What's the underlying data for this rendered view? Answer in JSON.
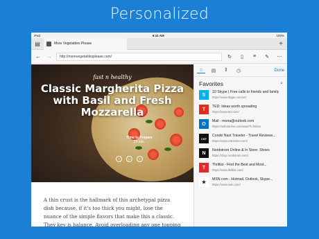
{
  "headline": "Personalized",
  "status": {
    "left": "iPad",
    "time": "9:41 AM",
    "battery": "100%"
  },
  "tab": {
    "title": "More Vegetables Please"
  },
  "address": {
    "url": "http://morevegetablesplease.com/"
  },
  "hero": {
    "brand": "fast n healthy",
    "title": "Classic Margherita Pizza with Basil and Fresh Mozzarella",
    "prep_label": "Time to Prepare",
    "prep_value": "25 min."
  },
  "article": {
    "text": "A thin crust is the hallmark of this archetypal pizza dish because, if it's too thick you might, lose the nuance of the simple flavors that make this a classic. They key is balance. Avoid overloading any one topping or flavor. Instead, let the simple ingredients"
  },
  "hub": {
    "done": "Done",
    "title": "Favorites",
    "items": [
      {
        "title": "10 Skype | Free calls to friends and family",
        "url": "https://www.skype.com/en/",
        "icon": "skype-icon",
        "color": "#00aff0",
        "glyph": "S"
      },
      {
        "title": "TED: Ideas worth spreading",
        "url": "https://www.ted.com/",
        "icon": "ted-icon",
        "color": "#e62b1e",
        "glyph": "T"
      },
      {
        "title": "Mail - mona@outlook.com",
        "url": "https://outlook.live.com/owa/?f=fmbox",
        "icon": "outlook-icon",
        "color": "#0072c6",
        "glyph": "O"
      },
      {
        "title": "Condé Nast Traveler - Travel Reviews...",
        "url": "https://www.cntraveler.com/",
        "icon": "cnt-icon",
        "color": "#111111",
        "glyph": "CNT"
      },
      {
        "title": "Nordstrom Online & In Store: Shoes",
        "url": "https://shop.nordstrom.com/",
        "icon": "nordstrom-icon",
        "color": "#111111",
        "glyph": "N"
      },
      {
        "title": "Thrillist - Find the Best and Most...",
        "url": "https://www.thrillist.com/",
        "icon": "thrillist-icon",
        "color": "#e8262b",
        "glyph": "T"
      },
      {
        "title": "MSN.com - Hotmail, Outlook, Skype...",
        "url": "https://www.msn.com/",
        "icon": "msn-icon",
        "color": "#ffffff",
        "glyph": "★"
      }
    ]
  }
}
